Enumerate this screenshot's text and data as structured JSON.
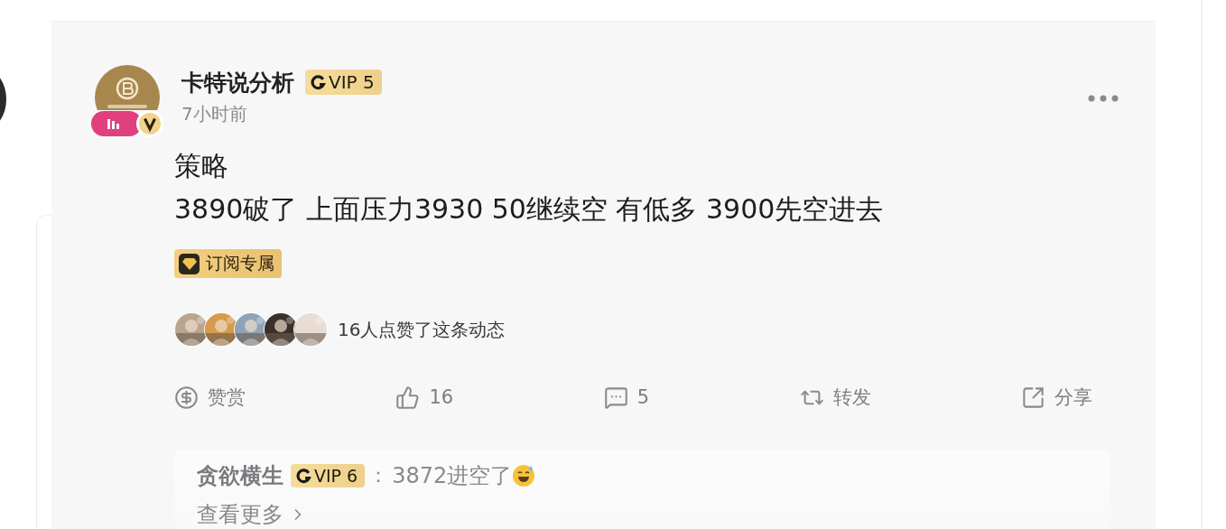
{
  "post": {
    "author": {
      "name": "卡特说分析",
      "vip": "VIP 5",
      "live": true,
      "verified": true
    },
    "time": "7小时前",
    "content": [
      "策略",
      "3890破了 上面压力3930 50继续空 有低多 3900先空进去"
    ],
    "tag": "订阅专属",
    "likes_text": "16人点赞了这条动态",
    "actions": [
      {
        "kind": "reward",
        "label": "赞赏"
      },
      {
        "kind": "like",
        "label": "16"
      },
      {
        "kind": "comment",
        "label": "5"
      },
      {
        "kind": "repost",
        "label": "转发"
      },
      {
        "kind": "share",
        "label": "分享"
      }
    ],
    "comment": {
      "name": "贪欲横生",
      "vip": "VIP 6",
      "separator": "：",
      "text": "3872进空了",
      "emoji": true
    },
    "more": "查看更多"
  }
}
